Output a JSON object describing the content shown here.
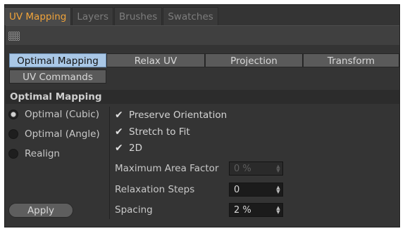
{
  "tabs": [
    "UV Mapping",
    "Layers",
    "Brushes",
    "Swatches"
  ],
  "subtabs": [
    "Optimal Mapping",
    "Relax UV",
    "Projection",
    "Transform",
    "UV Commands"
  ],
  "section_title": "Optimal Mapping",
  "radios": [
    {
      "label": "Optimal (Cubic)",
      "selected": true
    },
    {
      "label": "Optimal (Angle)",
      "selected": false
    },
    {
      "label": "Realign",
      "selected": false
    }
  ],
  "checkboxes": [
    {
      "label": "Preserve Orientation",
      "checked": true
    },
    {
      "label": "Stretch to Fit",
      "checked": true
    },
    {
      "label": "2D",
      "checked": true
    }
  ],
  "fields": [
    {
      "label": "Maximum Area Factor",
      "value": "0 %",
      "disabled": true
    },
    {
      "label": "Relaxation Steps",
      "value": "0",
      "disabled": false
    },
    {
      "label": "Spacing",
      "value": "2 %",
      "disabled": false
    }
  ],
  "apply_label": "Apply",
  "colors": {
    "active_tab": "#f0a33a",
    "active_subtab": "#a9c7e6",
    "panel": "#343434"
  }
}
